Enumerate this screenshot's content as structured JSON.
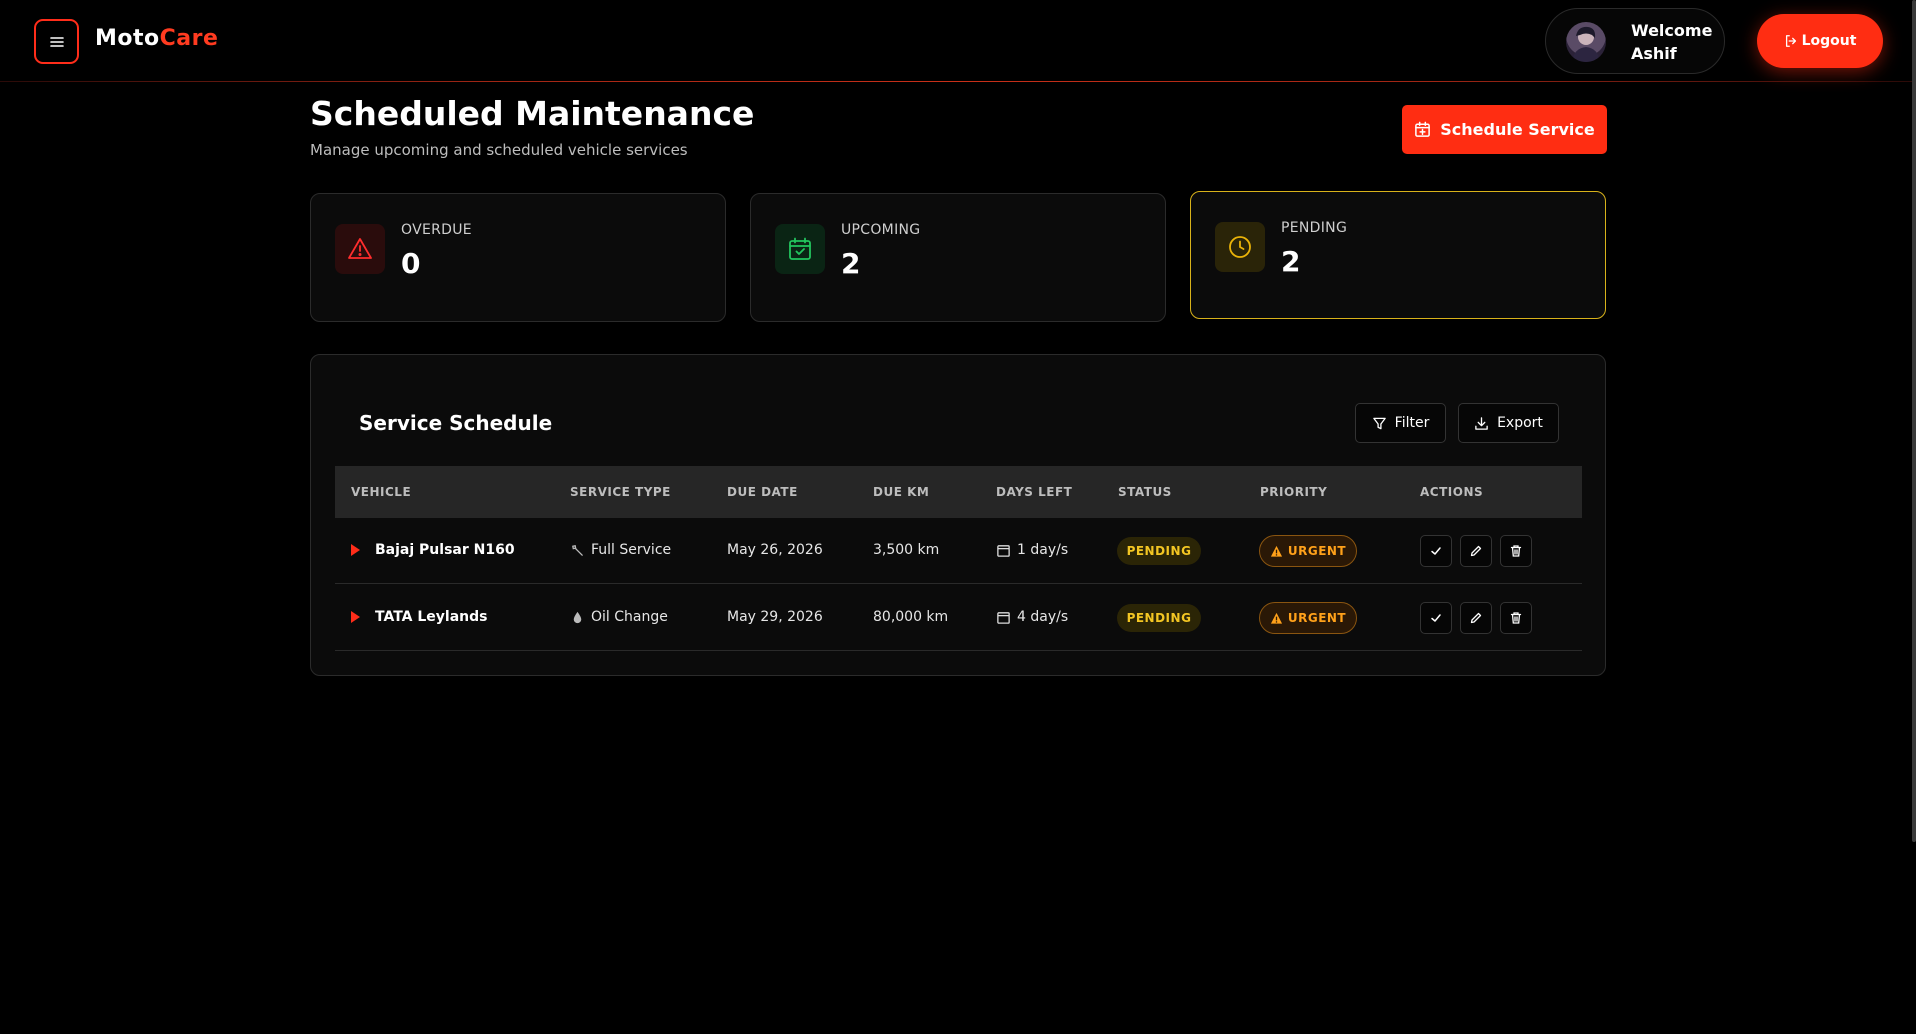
{
  "navbar": {
    "brand_part1": "Moto",
    "brand_part2": "Care",
    "welcome_line1": "Welcome",
    "welcome_line2": "Ashif",
    "logout_label": "Logout"
  },
  "header": {
    "title": "Scheduled Maintenance",
    "subtitle": "Manage upcoming and scheduled vehicle services",
    "schedule_button": "Schedule Service"
  },
  "stats": [
    {
      "label": "OVERDUE",
      "value": "0",
      "icon": "warning-triangle-icon",
      "color": "#ff2d2d"
    },
    {
      "label": "UPCOMING",
      "value": "2",
      "icon": "calendar-check-icon",
      "color": "#22c55e"
    },
    {
      "label": "PENDING",
      "value": "2",
      "icon": "clock-icon",
      "color": "#eab308"
    }
  ],
  "schedule": {
    "title": "Service Schedule",
    "filter_label": "Filter",
    "export_label": "Export",
    "columns": [
      "VEHICLE",
      "SERVICE TYPE",
      "DUE DATE",
      "DUE KM",
      "DAYS LEFT",
      "STATUS",
      "PRIORITY",
      "ACTIONS"
    ],
    "rows": [
      {
        "vehicle": "Bajaj Pulsar N160",
        "service_type": "Full Service",
        "service_icon": "wrench-icon",
        "due_date": "May 26, 2026",
        "due_km": "3,500 km",
        "days_left": "1 day/s",
        "status": "PENDING",
        "priority": "URGENT"
      },
      {
        "vehicle": "TATA Leylands",
        "service_type": "Oil Change",
        "service_icon": "oil-drop-icon",
        "due_date": "May 29, 2026",
        "due_km": "80,000 km",
        "days_left": "4 day/s",
        "status": "PENDING",
        "priority": "URGENT"
      }
    ]
  },
  "colors": {
    "accent": "#ff2d12",
    "background": "#000000",
    "card": "#0b0b0b",
    "pending_badge": "#f3c623",
    "urgent_badge": "#ffa11a"
  }
}
